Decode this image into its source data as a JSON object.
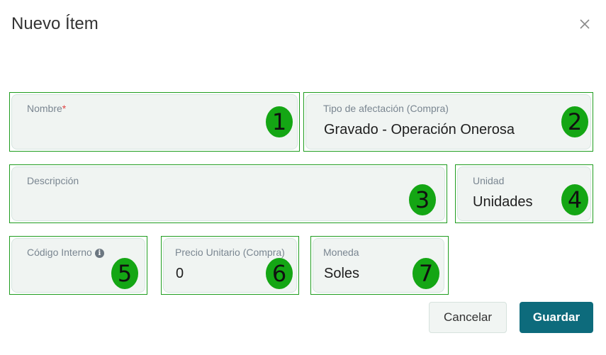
{
  "dialog": {
    "title": "Nuevo Ítem"
  },
  "fields": {
    "nombre": {
      "label": "Nombre",
      "required_mark": "*",
      "value": "",
      "badge": "1"
    },
    "tipo_afectacion": {
      "label": "Tipo de afectación (Compra)",
      "value": "Gravado - Operación Onerosa",
      "badge": "2"
    },
    "descripcion": {
      "label": "Descripción",
      "value": "",
      "badge": "3"
    },
    "unidad": {
      "label": "Unidad",
      "value": "Unidades",
      "badge": "4"
    },
    "codigo_interno": {
      "label": "Código Interno",
      "info_icon": "i",
      "value": "",
      "badge": "5"
    },
    "precio_unitario": {
      "label": "Precio Unitario (Compra)",
      "value": "0",
      "badge": "6"
    },
    "moneda": {
      "label": "Moneda",
      "value": "Soles",
      "badge": "7"
    }
  },
  "buttons": {
    "cancel": "Cancelar",
    "save": "Guardar"
  },
  "icons": {
    "close": "close-icon",
    "info": "info-icon"
  },
  "colors": {
    "primary": "#0d6b7c",
    "annotation_border": "#1f9d1f",
    "badge": "#14a614",
    "required": "#e04343"
  }
}
